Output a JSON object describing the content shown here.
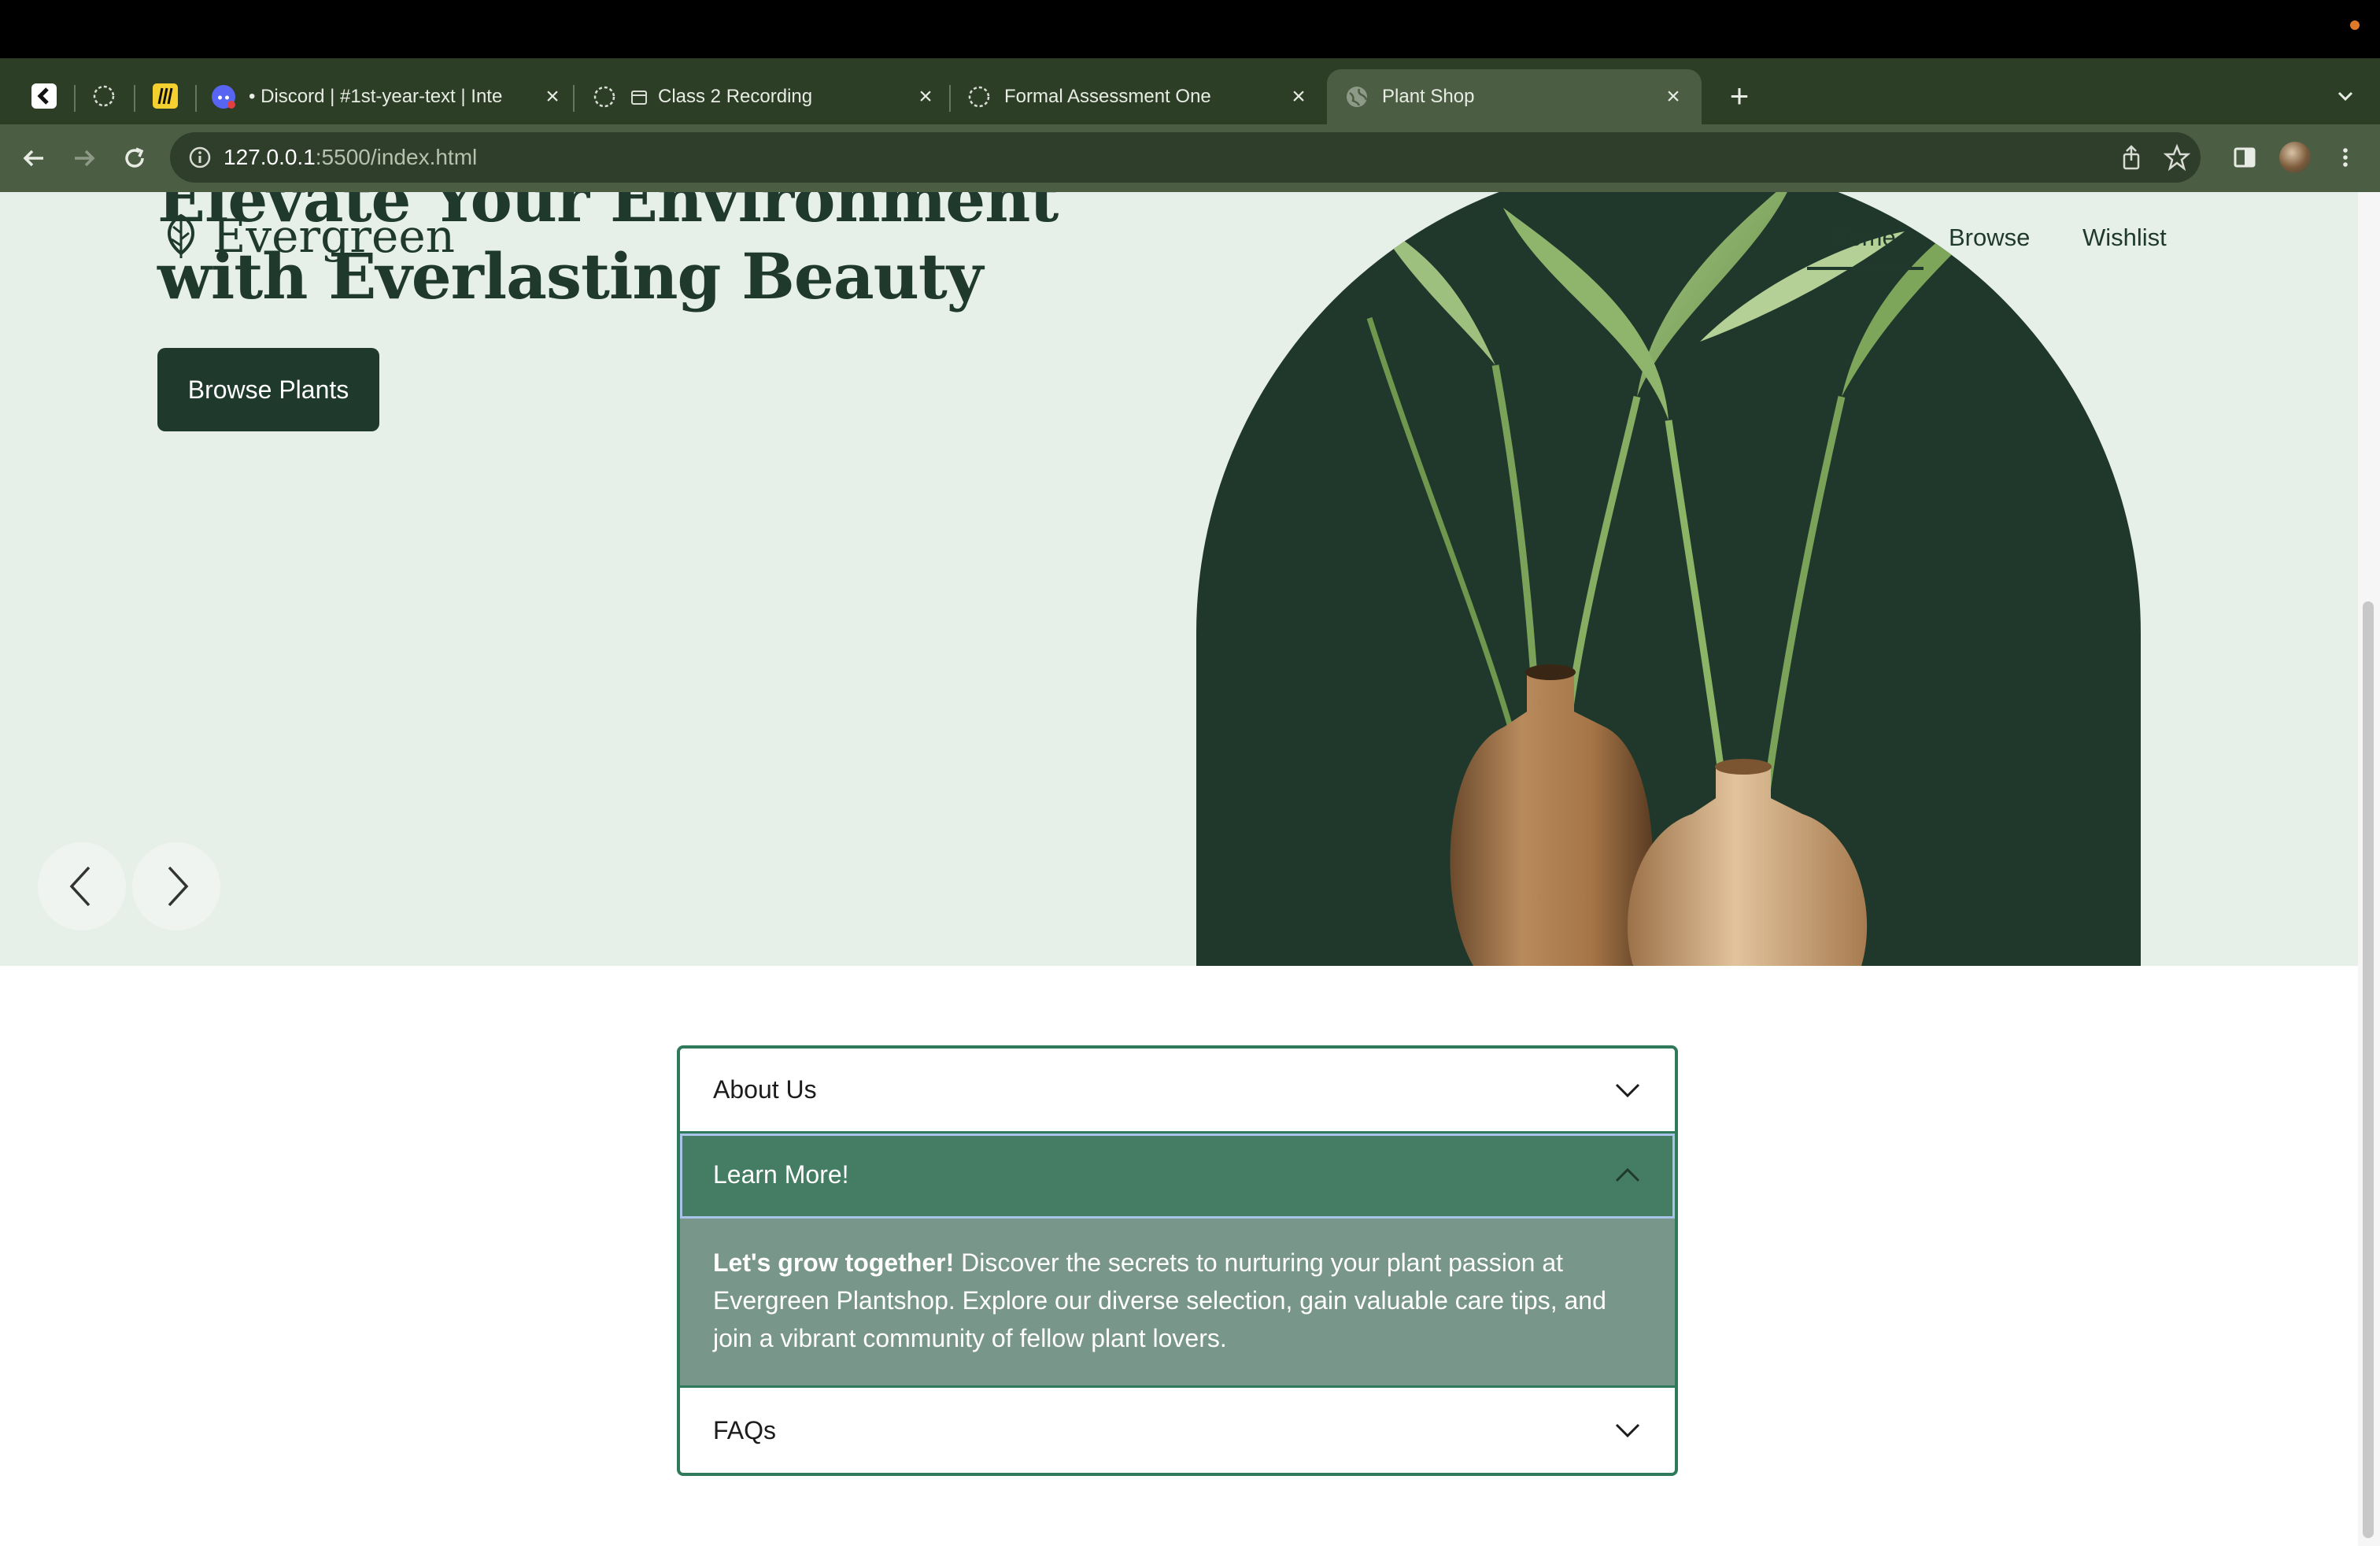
{
  "browser": {
    "tabs": [
      {
        "label": "• Discord | #1st-year-text | Inte",
        "icon": "discord-icon"
      },
      {
        "label": "Class 2 Recording",
        "icon": "loading-icon"
      },
      {
        "label": "Formal Assessment One",
        "icon": "loading-icon"
      },
      {
        "label": "Plant Shop",
        "icon": "globe-icon",
        "active": true
      }
    ],
    "pinned_icons": [
      "back-app-icon",
      "loading-icon",
      "miro-icon"
    ],
    "url_host": "127.0.0.1",
    "url_rest": ":5500/index.html"
  },
  "hero": {
    "title_line1": "Elevate Your Environment",
    "title_line2": "with Everlasting Beauty",
    "browse_label": "Browse Plants"
  },
  "nav": {
    "brand": "Evergreen",
    "home": "Home",
    "browse": "Browse",
    "wishlist": "Wishlist"
  },
  "accordion": {
    "items": [
      {
        "title": "About Us",
        "expanded": false
      },
      {
        "title": "Learn More!",
        "expanded": true,
        "body_strong": "Let's grow together!",
        "body_text": " Discover the secrets to nurturing your plant passion at Evergreen Plantshop. Explore our diverse selection, gain valuable care tips, and join a vibrant community of fellow plant lovers."
      },
      {
        "title": "FAQs",
        "expanded": false
      }
    ]
  },
  "colors": {
    "brand_dark": "#1f3a2d",
    "hero_bg": "#e6efe8",
    "accent": "#447d63",
    "panel": "#78968a"
  }
}
